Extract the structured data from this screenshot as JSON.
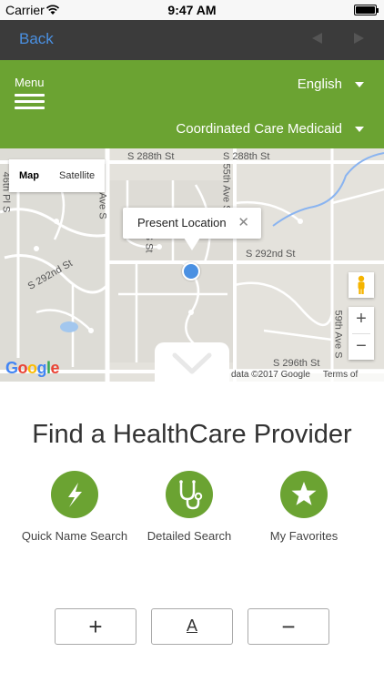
{
  "status_bar": {
    "carrier": "Carrier",
    "time": "9:47 AM"
  },
  "nav": {
    "back_label": "Back",
    "prev_icon": "chevron-left-icon",
    "next_icon": "chevron-right-icon"
  },
  "header": {
    "menu_label": "Menu",
    "language": "English",
    "plan": "Coordinated Care Medicaid",
    "accent_color": "#6ba332"
  },
  "map": {
    "type_options": [
      "Map",
      "Satellite"
    ],
    "selected_type": "Map",
    "popup_text": "Present Location",
    "close_glyph": "✕",
    "street_labels": {
      "s288th_left": "S 288th St",
      "s288th_right": "S 288th St",
      "s292nd_left": "S 292nd St",
      "s292nd_right": "S 292nd St",
      "ave55": "55th Ave S",
      "ave59": "59th Ave S",
      "pl46": "46th Pl S",
      "ave_s": "Ave S",
      "st_s": "S St",
      "s296": "S 296th St",
      "edge": "S"
    },
    "zoom_in": "+",
    "zoom_out": "−",
    "logo": "Google",
    "attribution_data": "data ©2017 Google",
    "attribution_terms": "Terms of Use"
  },
  "main": {
    "title": "Find a HealthCare Provider",
    "options": [
      {
        "label": "Quick Name Search",
        "icon": "lightning-icon"
      },
      {
        "label": "Detailed Search",
        "icon": "stethoscope-icon"
      },
      {
        "label": "My Favorites",
        "icon": "star-icon"
      }
    ]
  },
  "bottom_controls": {
    "increase_glyph": "+",
    "text_glyph": "A",
    "decrease_glyph": "−"
  }
}
